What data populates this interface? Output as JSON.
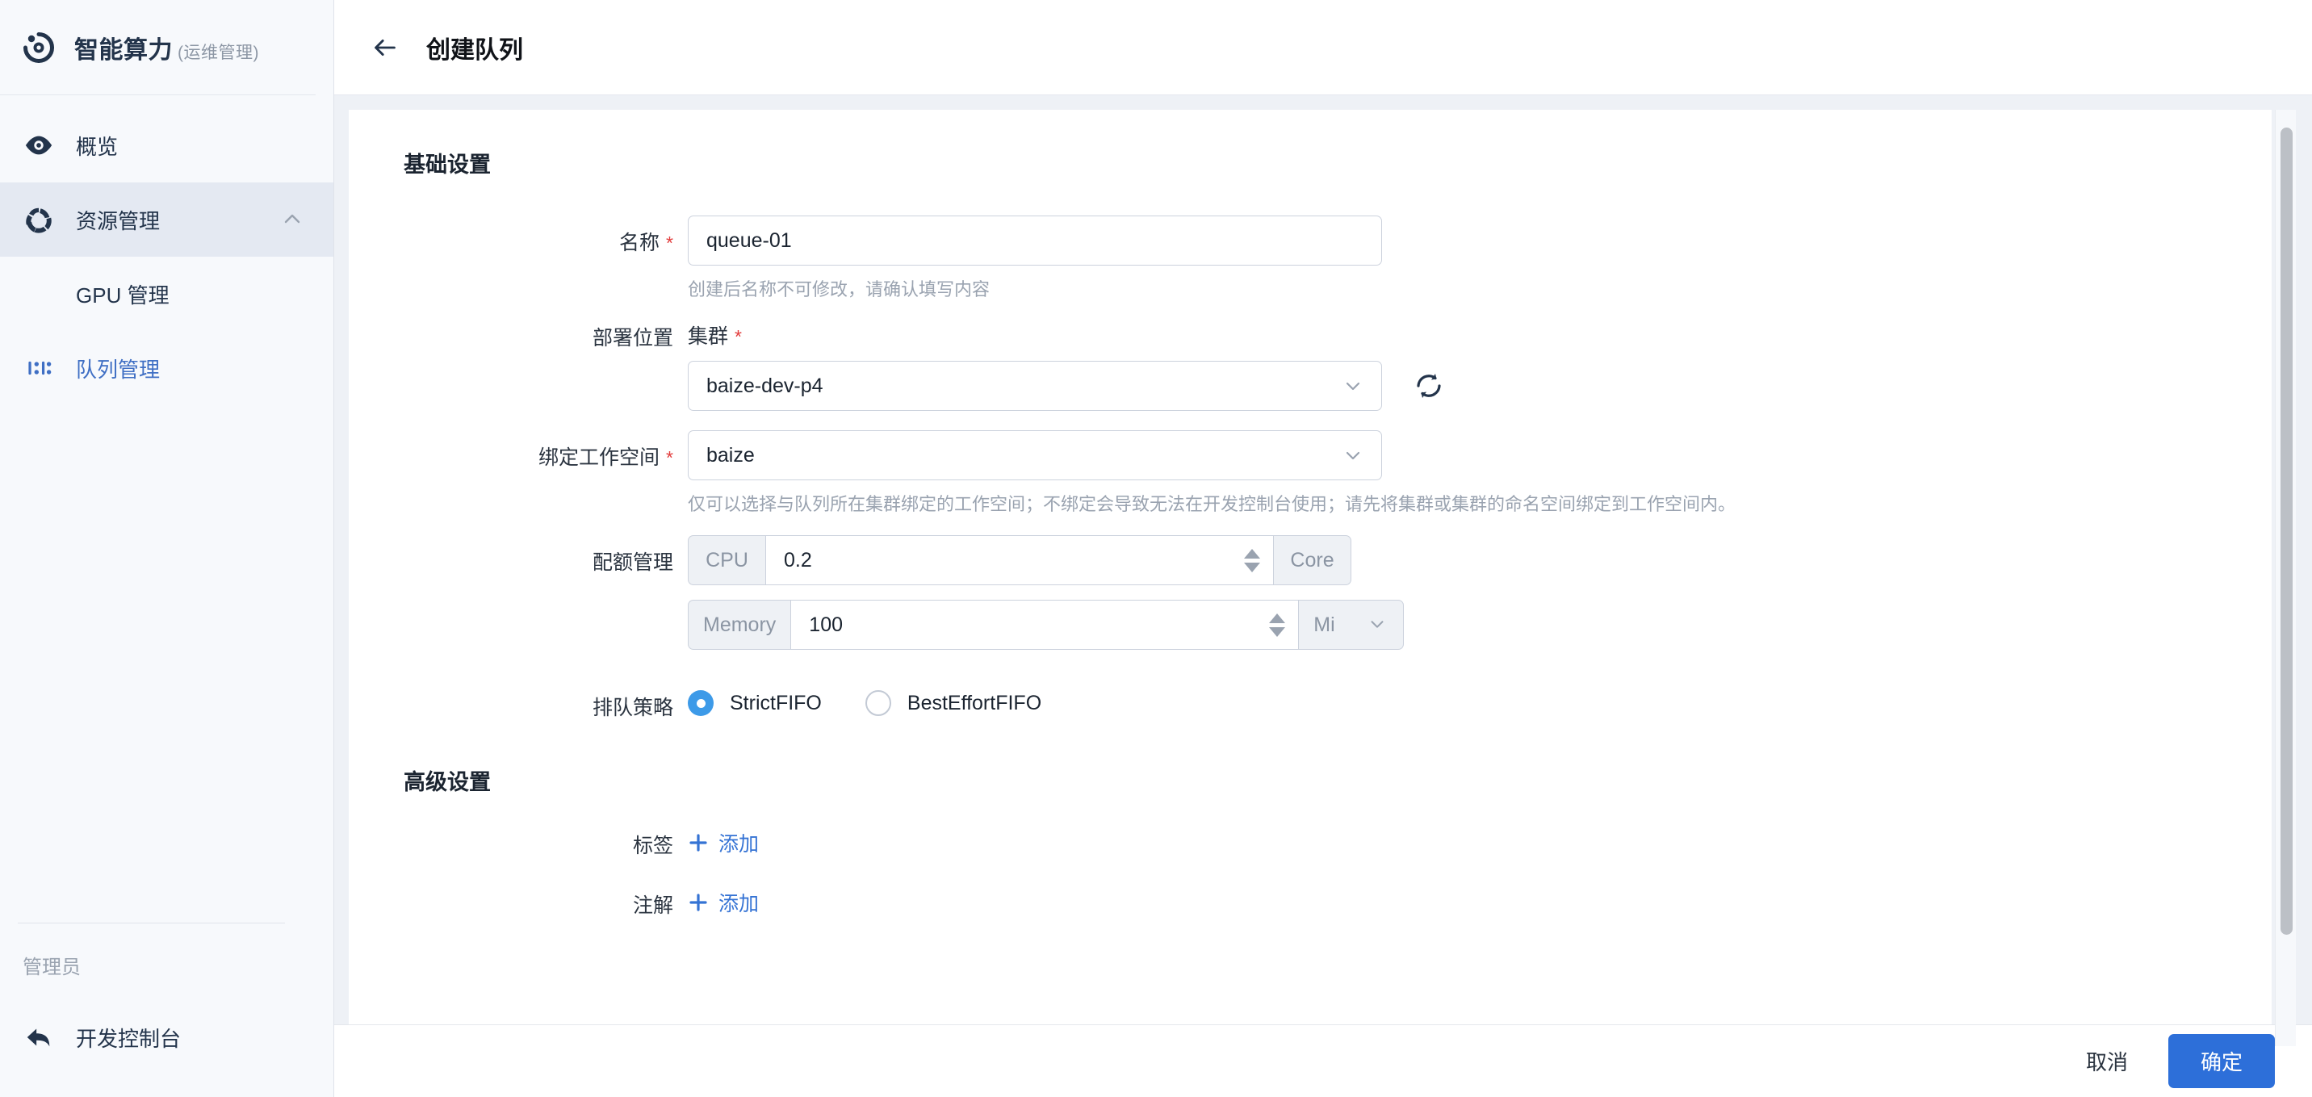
{
  "brand": {
    "name": "智能算力",
    "suffix": "(运维管理)",
    "logo_icon": "radar-target-icon"
  },
  "sidebar": {
    "items": [
      {
        "label": "概览",
        "icon": "eye-icon"
      },
      {
        "label": "资源管理",
        "icon": "resource-recycle-icon",
        "chevron": "chevron-up-icon"
      },
      {
        "label": "GPU 管理",
        "icon": ""
      },
      {
        "label": "队列管理",
        "icon": "queue-icon"
      }
    ],
    "role_label": "管理员",
    "console_label": "开发控制台",
    "console_icon": "reply-arrow-icon"
  },
  "header": {
    "back_icon": "arrow-left-icon",
    "title": "创建队列"
  },
  "form": {
    "basic_section_title": "基础设置",
    "advanced_section_title": "高级设置",
    "name": {
      "label": "名称",
      "value": "queue-01",
      "placeholder": "",
      "help": "创建后名称不可修改，请确认填写内容"
    },
    "deploy": {
      "label": "部署位置",
      "cluster_sub_label": "集群",
      "cluster_value": "baize-dev-p4",
      "refresh_icon": "refresh-icon"
    },
    "workspace": {
      "label": "绑定工作空间",
      "value": "baize",
      "help": "仅可以选择与队列所在集群绑定的工作空间；不绑定会导致无法在开发控制台使用；请先将集群或集群的命名空间绑定到工作空间内。"
    },
    "quota": {
      "label": "配额管理",
      "cpu_prefix": "CPU",
      "cpu_value": "0.2",
      "cpu_unit": "Core",
      "memory_prefix": "Memory",
      "memory_value": "100",
      "memory_unit": "Mi"
    },
    "strategy": {
      "label": "排队策略",
      "options": [
        {
          "label": "StrictFIFO",
          "selected": true
        },
        {
          "label": "BestEffortFIFO",
          "selected": false
        }
      ]
    },
    "labels_field": {
      "label": "标签",
      "add_text": "添加"
    },
    "annotations_field": {
      "label": "注解",
      "add_text": "添加"
    }
  },
  "footer": {
    "cancel_label": "取消",
    "confirm_label": "确定"
  },
  "colors": {
    "accent_blue": "#2d6fd9",
    "nav_active_blue": "#3f6fc4",
    "radio_blue": "#3d9ae8",
    "required_red": "#e23c3c",
    "sidebar_bg": "#f7f9fc"
  }
}
